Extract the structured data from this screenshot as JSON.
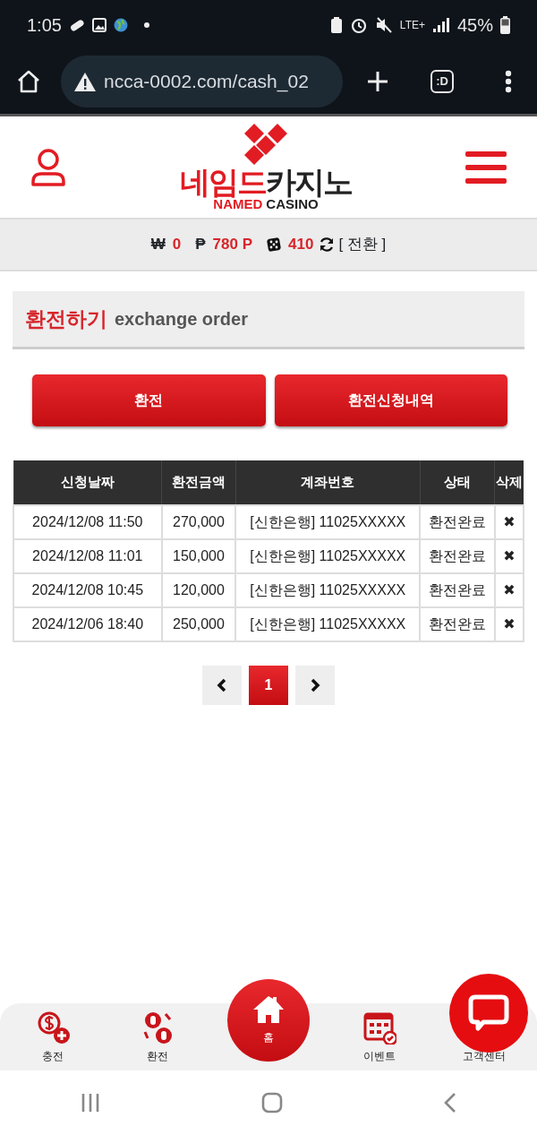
{
  "status_bar": {
    "time": "1:05",
    "network": "LTE+",
    "battery": "45%"
  },
  "browser": {
    "url": "ncca-0002.com/cash_02",
    "tabs_label": ":D"
  },
  "header": {
    "logo_korean": [
      {
        "text": "네임드",
        "accent": true
      },
      {
        "text": "카지노",
        "accent": false
      }
    ],
    "logo_english": [
      {
        "text": "NAMED",
        "accent": true
      },
      {
        "text": "CASINO",
        "accent": false
      }
    ]
  },
  "balance": {
    "items": [
      {
        "kind": "symbol",
        "symbol": "₩",
        "value": "0"
      },
      {
        "kind": "symbol",
        "symbol": "₱",
        "value": "780 P"
      },
      {
        "kind": "chip",
        "value": "410"
      }
    ],
    "convert_label": "[ 전환 ]"
  },
  "section": {
    "title": "환전하기",
    "subtitle": "exchange order"
  },
  "buttons": [
    "환전",
    "환전신청내역"
  ],
  "table": {
    "columns": [
      "신청날짜",
      "환전금액",
      "계좌번호",
      "상태",
      "삭제"
    ],
    "rows": [
      {
        "date": "2024/12/08 11:50",
        "amount": "270,000",
        "account": "[신한은행] 11025XXXXX",
        "status": "환전완료",
        "delete": "✖"
      },
      {
        "date": "2024/12/08 11:01",
        "amount": "150,000",
        "account": "[신한은행] 11025XXXXX",
        "status": "환전완료",
        "delete": "✖"
      },
      {
        "date": "2024/12/08 10:45",
        "amount": "120,000",
        "account": "[신한은행] 11025XXXXX",
        "status": "환전완료",
        "delete": "✖"
      },
      {
        "date": "2024/12/06 18:40",
        "amount": "250,000",
        "account": "[신한은행] 11025XXXXX",
        "status": "환전완료",
        "delete": "✖"
      }
    ]
  },
  "pagination": {
    "pages": [
      {
        "label": "1",
        "selected": true
      }
    ]
  },
  "bottom_nav": [
    {
      "kind": "charge",
      "label": "충전"
    },
    {
      "kind": "exchange",
      "label": "환전"
    },
    {
      "kind": "home",
      "label": "홈"
    },
    {
      "kind": "event",
      "label": "이벤트"
    },
    {
      "kind": "support",
      "label": "고객센터"
    }
  ]
}
